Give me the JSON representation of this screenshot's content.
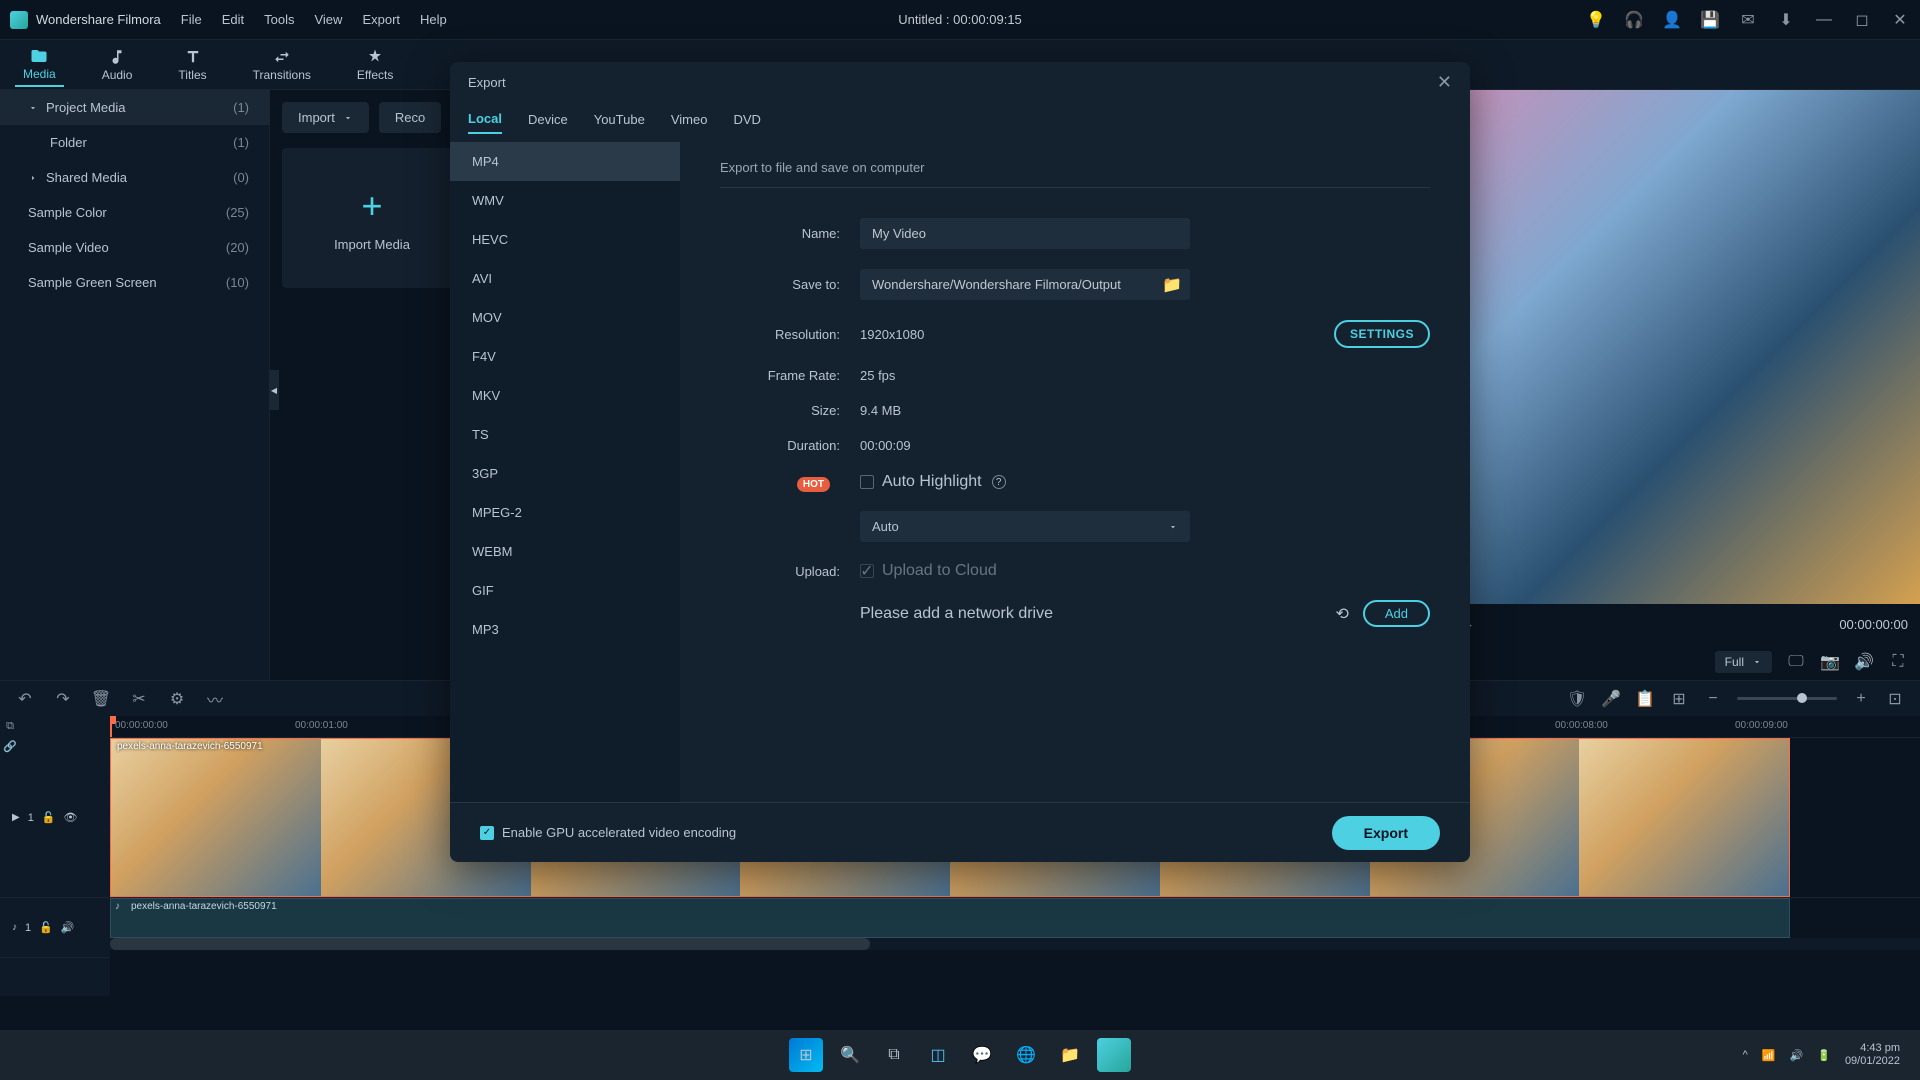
{
  "app": {
    "name": "Wondershare Filmora",
    "title": "Untitled : 00:00:09:15"
  },
  "menu": [
    "File",
    "Edit",
    "Tools",
    "View",
    "Export",
    "Help"
  ],
  "tabs": [
    {
      "label": "Media",
      "active": true
    },
    {
      "label": "Audio",
      "active": false
    },
    {
      "label": "Titles",
      "active": false
    },
    {
      "label": "Transitions",
      "active": false
    },
    {
      "label": "Effects",
      "active": false
    }
  ],
  "sidebar": {
    "items": [
      {
        "label": "Project Media",
        "count": "(1)",
        "active": true,
        "chev": "down"
      },
      {
        "label": "Folder",
        "count": "(1)",
        "indent": true
      },
      {
        "label": "Shared Media",
        "count": "(0)",
        "chev": "right"
      },
      {
        "label": "Sample Color",
        "count": "(25)"
      },
      {
        "label": "Sample Video",
        "count": "(20)"
      },
      {
        "label": "Sample Green Screen",
        "count": "(10)"
      }
    ]
  },
  "import": {
    "button": "Import",
    "record": "Reco",
    "tile": "Import Media"
  },
  "preview": {
    "timecode": "00:00:00:00",
    "quality": "Full"
  },
  "timeline": {
    "marks": [
      "00:00:00:00",
      "00:00:01:00",
      "00:00:08:00",
      "00:00:09:00"
    ],
    "video_clip": "pexels-anna-tarazevich-6550971",
    "audio_clip": "pexels-anna-tarazevich-6550971",
    "video_track_label": "1",
    "audio_track_label": "1"
  },
  "export": {
    "title": "Export",
    "tabs": [
      "Local",
      "Device",
      "YouTube",
      "Vimeo",
      "DVD"
    ],
    "active_tab": "Local",
    "formats": [
      "MP4",
      "WMV",
      "HEVC",
      "AVI",
      "MOV",
      "F4V",
      "MKV",
      "TS",
      "3GP",
      "MPEG-2",
      "WEBM",
      "GIF",
      "MP3"
    ],
    "active_format": "MP4",
    "desc": "Export to file and save on computer",
    "labels": {
      "name": "Name:",
      "save_to": "Save to:",
      "resolution": "Resolution:",
      "frame_rate": "Frame Rate:",
      "size": "Size:",
      "duration": "Duration:",
      "upload": "Upload:"
    },
    "values": {
      "name": "My Video",
      "save_to": "Wondershare/Wondershare Filmora/Output",
      "resolution": "1920x1080",
      "frame_rate": "25 fps",
      "size": "9.4 MB",
      "duration": "00:00:09",
      "auto_highlight": "Auto Highlight",
      "auto_select": "Auto",
      "upload_cloud": "Upload to Cloud",
      "network_drive": "Please add a network drive"
    },
    "buttons": {
      "settings": "SETTINGS",
      "add": "Add",
      "export": "Export",
      "gpu": "Enable GPU accelerated video encoding",
      "hot": "HOT"
    }
  },
  "taskbar": {
    "time": "4:43 pm",
    "date": "09/01/2022"
  }
}
